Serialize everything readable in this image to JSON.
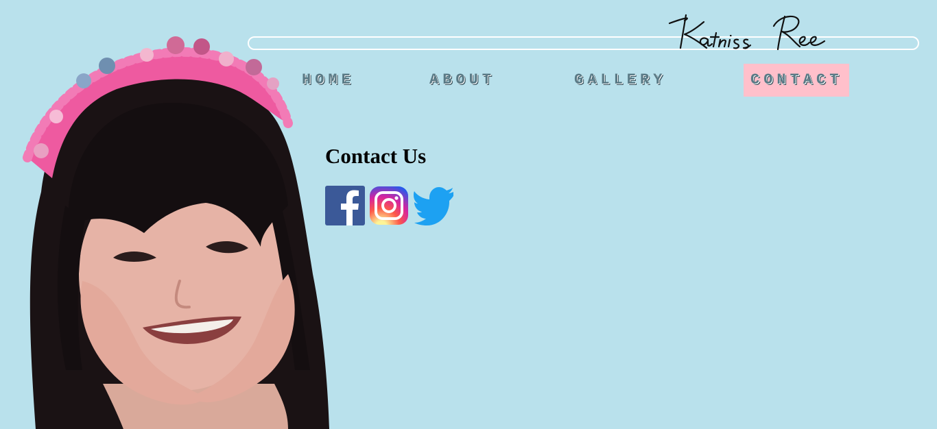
{
  "site": {
    "logo_text": "Katniss Ree"
  },
  "nav": {
    "items": [
      {
        "label": "HOME",
        "active": false
      },
      {
        "label": "ABOUT",
        "active": false
      },
      {
        "label": "GALLERY",
        "active": false
      },
      {
        "label": "CONTACT",
        "active": true
      }
    ]
  },
  "contact": {
    "title": "Contact Us",
    "social": [
      {
        "icon": "facebook-icon",
        "color": "#3b5998"
      },
      {
        "icon": "instagram-icon",
        "color": "#c13584"
      },
      {
        "icon": "twitter-icon",
        "color": "#1da1f2"
      }
    ]
  },
  "colors": {
    "background": "#b9e1ec",
    "nav_active_bg": "#ffc0cb",
    "nav_text": "#5a7a86"
  }
}
